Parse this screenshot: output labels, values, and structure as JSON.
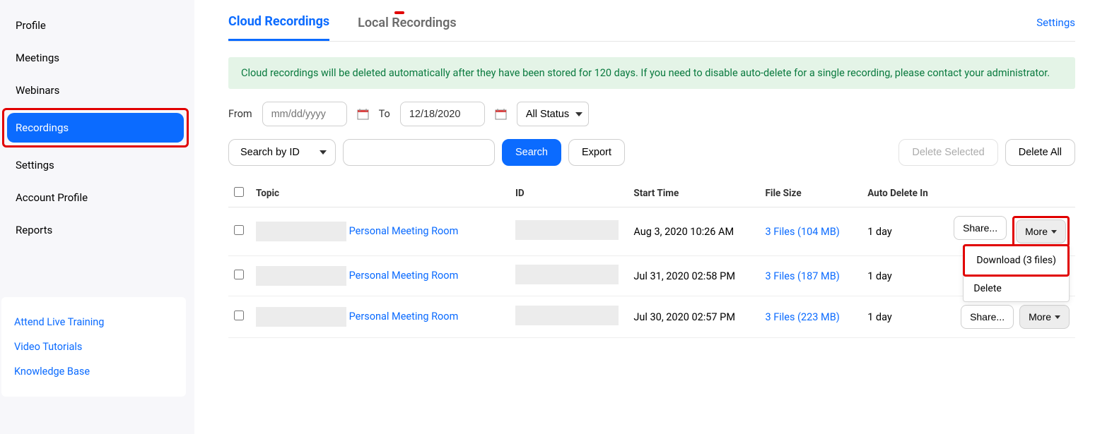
{
  "sidebar": {
    "items": [
      {
        "label": "Profile"
      },
      {
        "label": "Meetings"
      },
      {
        "label": "Webinars"
      },
      {
        "label": "Recordings"
      },
      {
        "label": "Settings"
      },
      {
        "label": "Account Profile"
      },
      {
        "label": "Reports"
      }
    ],
    "links": [
      {
        "label": "Attend Live Training"
      },
      {
        "label": "Video Tutorials"
      },
      {
        "label": "Knowledge Base"
      }
    ]
  },
  "tabs": {
    "cloud": "Cloud Recordings",
    "local": "Local Recordings",
    "settings_link": "Settings"
  },
  "banner": "Cloud recordings will be deleted automatically after they have been stored for 120 days. If you need to disable auto-delete for a single recording, please contact your administrator.",
  "filters": {
    "from_label": "From",
    "to_label": "To",
    "from_placeholder": "mm/dd/yyyy",
    "to_value": "12/18/2020",
    "status": "All Status"
  },
  "search": {
    "by_label": "Search by ID",
    "search_btn": "Search",
    "export_btn": "Export",
    "delete_selected": "Delete Selected",
    "delete_all": "Delete All"
  },
  "columns": {
    "topic": "Topic",
    "id": "ID",
    "start": "Start Time",
    "file": "File Size",
    "auto": "Auto Delete In"
  },
  "rows": [
    {
      "topic": "Personal Meeting Room",
      "start": "Aug 3, 2020 10:26 AM",
      "file": "3 Files (104 MB)",
      "auto": "1 day"
    },
    {
      "topic": "Personal Meeting Room",
      "start": "Jul 31, 2020 02:58 PM",
      "file": "3 Files (187 MB)",
      "auto": "1 day"
    },
    {
      "topic": "Personal Meeting Room",
      "start": "Jul 30, 2020 02:57 PM",
      "file": "3 Files (223 MB)",
      "auto": "1 day"
    }
  ],
  "row_actions": {
    "share": "Share...",
    "more": "More"
  },
  "dropdown": {
    "download": "Download (3 files)",
    "delete": "Delete"
  }
}
